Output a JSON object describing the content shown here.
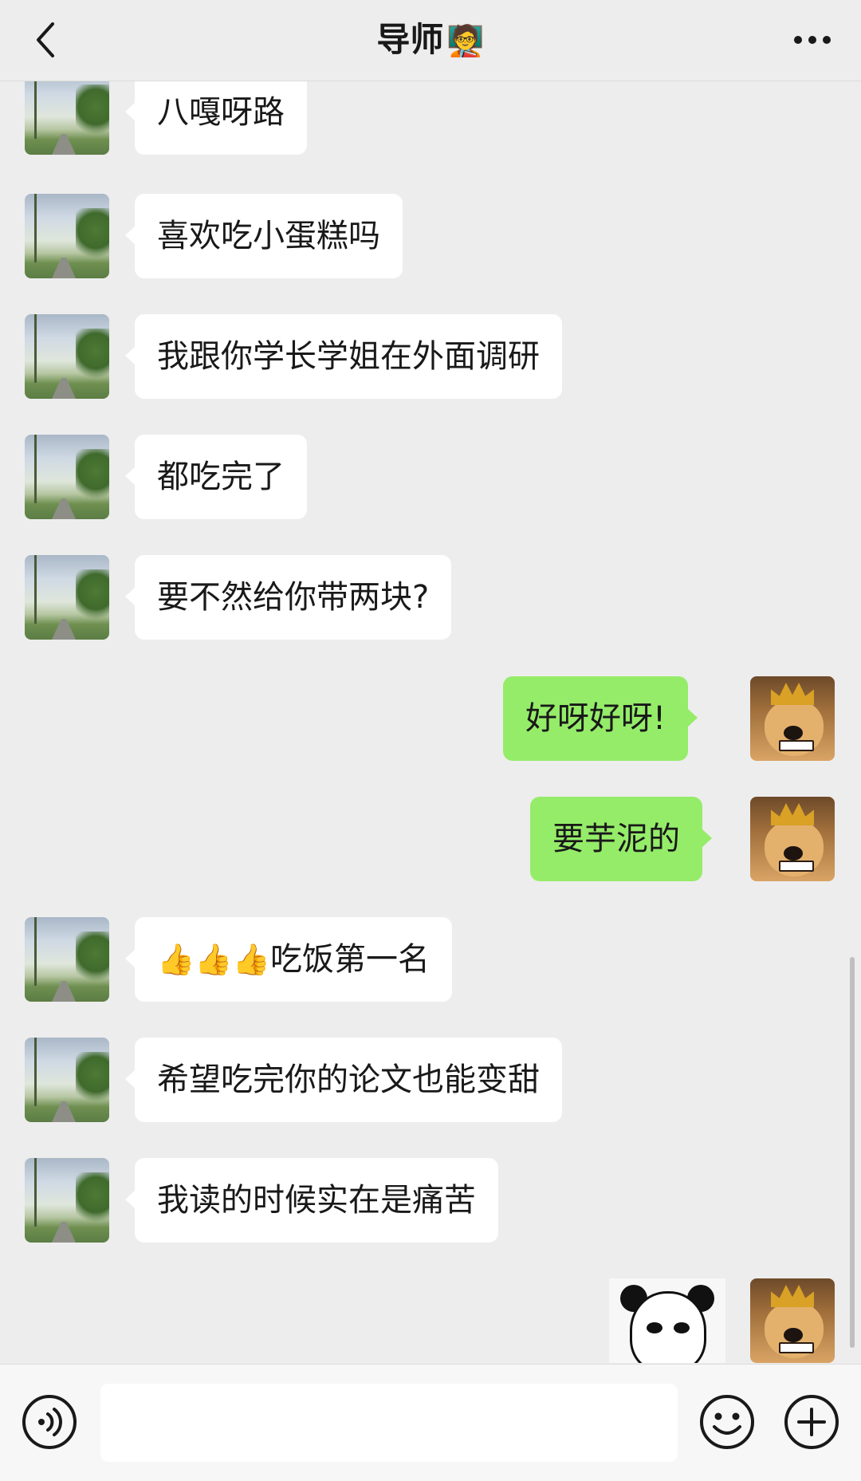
{
  "header": {
    "title": "导师",
    "title_emoji": "🧑‍🏫"
  },
  "messages": [
    {
      "side": "left",
      "text": "八嘎呀路"
    },
    {
      "side": "left",
      "text": "喜欢吃小蛋糕吗"
    },
    {
      "side": "left",
      "text": "我跟你学长学姐在外面调研"
    },
    {
      "side": "left",
      "text": "都吃完了"
    },
    {
      "side": "left",
      "text": "要不然给你带两块?"
    },
    {
      "side": "right",
      "text": "好呀好呀!"
    },
    {
      "side": "right",
      "text": "要芋泥的"
    },
    {
      "side": "left",
      "emoji": "👍👍👍",
      "text": "吃饭第一名"
    },
    {
      "side": "left",
      "text": "希望吃完你的论文也能变甜"
    },
    {
      "side": "left",
      "text": "我读的时候实在是痛苦"
    },
    {
      "side": "right",
      "type": "sticker",
      "sticker": "panda-meme"
    }
  ],
  "input_bar": {
    "voice_icon": "voice-icon",
    "emoji_icon": "smiley-icon",
    "plus_icon": "plus-icon",
    "input_value": ""
  },
  "colors": {
    "background": "#ededed",
    "bubble_left": "#ffffff",
    "bubble_right": "#95ec69",
    "text": "#191919"
  }
}
